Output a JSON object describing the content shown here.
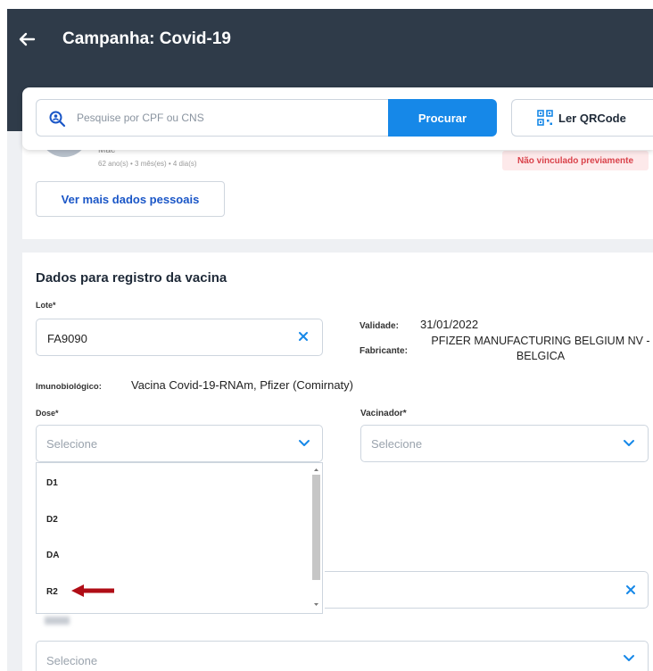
{
  "header": {
    "title": "Campanha: Covid-19"
  },
  "search": {
    "placeholder": "Pesquise por CPF ou CNS",
    "button_label": "Procurar",
    "qr_button_label": "Ler QRCode"
  },
  "person": {
    "relation": "Mãe",
    "age": "62 ano(s) • 3 mês(es) • 4 dia(s)",
    "status_badge": "Não vinculado previamente",
    "more_data_button": "Ver mais dados pessoais"
  },
  "vaccine_form": {
    "title": "Dados para registro da vacina",
    "lote_label": "Lote*",
    "lote_value": "FA9090",
    "validade_label": "Validade:",
    "validade_value": "31/01/2022",
    "fabricante_label": "Fabricante:",
    "fabricante_value": "PFIZER MANUFACTURING BELGIUM NV - BELGICA",
    "imuno_label": "Imunobiológico:",
    "imuno_value": "Vacina Covid-19-RNAm, Pfizer (Comirnaty)",
    "dose_label": "Dose*",
    "dose_placeholder": "Selecione",
    "vacinador_label": "Vacinador*",
    "vacinador_placeholder": "Selecione",
    "dose_options": [
      "D1",
      "D2",
      "DA",
      "R2"
    ],
    "bottom_placeholder": "Selecione"
  },
  "colors": {
    "header_bg": "#2f3b49",
    "primary": "#1688e8",
    "link": "#1a56c7",
    "badge_text": "#d9424a",
    "badge_bg": "#fde9ea",
    "annotation_arrow": "#b00d16"
  },
  "icons": {
    "back": "arrow-left-icon",
    "search": "person-search-icon",
    "qr": "qr-code-icon",
    "clear": "close-icon",
    "chevron": "chevron-down-icon"
  }
}
